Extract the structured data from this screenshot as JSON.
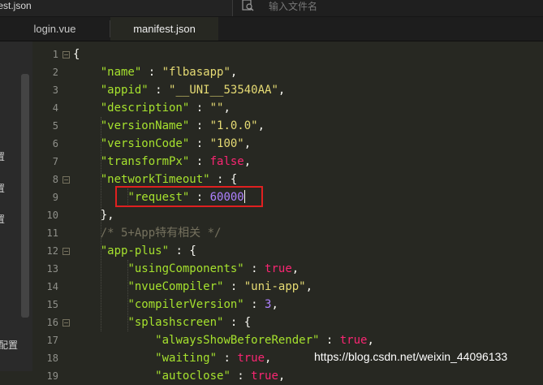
{
  "titlebar": {
    "crumb": "fest.json"
  },
  "search": {
    "placeholder": "输入文件名"
  },
  "tabs": [
    {
      "label": "login.vue",
      "active": false
    },
    {
      "label": "manifest.json",
      "active": true
    }
  ],
  "sidebar": {
    "glyphs": [
      "置",
      "置",
      "置",
      "配置"
    ]
  },
  "editor": {
    "line_numbers": [
      "1",
      "2",
      "3",
      "4",
      "5",
      "6",
      "7",
      "8",
      "9",
      "10",
      "11",
      "12",
      "13",
      "14",
      "15",
      "16",
      "17",
      "18",
      "19"
    ],
    "lines": [
      {
        "ind": "",
        "t": "{"
      },
      {
        "ind": "    ",
        "k": "\"name\"",
        "s": "\"flbasapp\"",
        "end": ","
      },
      {
        "ind": "    ",
        "k": "\"appid\"",
        "s": "\"__UNI__53540AA\"",
        "end": ","
      },
      {
        "ind": "    ",
        "k": "\"description\"",
        "s": "\"\"",
        "end": ","
      },
      {
        "ind": "    ",
        "k": "\"versionName\"",
        "s": "\"1.0.0\"",
        "end": ","
      },
      {
        "ind": "    ",
        "k": "\"versionCode\"",
        "s": "\"100\"",
        "end": ","
      },
      {
        "ind": "    ",
        "k": "\"transformPx\"",
        "b": "false",
        "end": ","
      },
      {
        "ind": "    ",
        "k": "\"networkTimeout\"",
        "o": "{"
      },
      {
        "ind": "        ",
        "k": "\"request\"",
        "n": "60000",
        "caret": true
      },
      {
        "ind": "    ",
        "t": "},"
      },
      {
        "ind": "    ",
        "c": "/* 5+App特有相关 */"
      },
      {
        "ind": "    ",
        "k": "\"app-plus\"",
        "o": "{"
      },
      {
        "ind": "        ",
        "k": "\"usingComponents\"",
        "b": "true",
        "end": ","
      },
      {
        "ind": "        ",
        "k": "\"nvueCompiler\"",
        "s": "\"uni-app\"",
        "end": ","
      },
      {
        "ind": "        ",
        "k": "\"compilerVersion\"",
        "n": "3",
        "end": ","
      },
      {
        "ind": "        ",
        "k": "\"splashscreen\"",
        "o": "{"
      },
      {
        "ind": "            ",
        "k": "\"alwaysShowBeforeRender\"",
        "b": "true",
        "end": ","
      },
      {
        "ind": "            ",
        "k": "\"waiting\"",
        "b": "true",
        "end": ","
      },
      {
        "ind": "            ",
        "k": "\"autoclose\"",
        "b": "true",
        "end": ","
      }
    ],
    "foldable_lines": [
      1,
      8,
      12,
      16
    ]
  },
  "watermark": "https://blog.csdn.net/weixin_44096133",
  "colors": {
    "background": "#272822",
    "key": "#a6e22e",
    "string": "#e6db74",
    "number": "#ae81ff",
    "boolean": "#f92672",
    "comment": "#75715e",
    "annotation_box": "#e02020"
  }
}
